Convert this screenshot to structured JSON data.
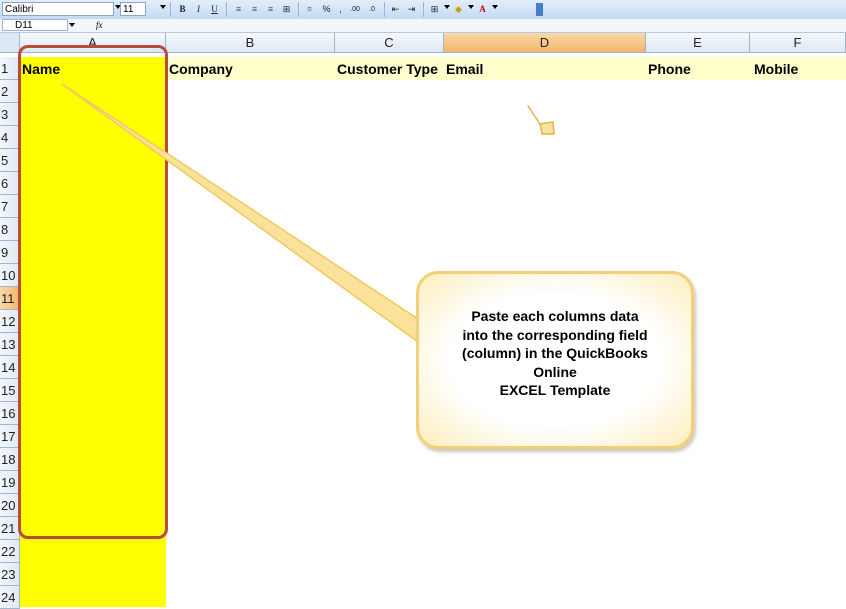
{
  "toolbar": {
    "font_name": "Calibri",
    "font_size": "11",
    "bold_label": "B",
    "italic_label": "I",
    "underline_label": "U",
    "percent_label": "%",
    "comma_label": ",",
    "increase_decimal_label": ".00",
    "decrease_decimal_label": ".0"
  },
  "formula_bar": {
    "name_box": "D11",
    "fx_label": "fx",
    "value": ""
  },
  "columns": [
    "A",
    "B",
    "C",
    "D",
    "E",
    "F"
  ],
  "active_column": "D",
  "active_row": 11,
  "rows": [
    "1",
    "2",
    "3",
    "4",
    "5",
    "6",
    "7",
    "8",
    "9",
    "10",
    "11",
    "12",
    "13",
    "14",
    "15",
    "16",
    "17",
    "18",
    "19",
    "20",
    "21",
    "22",
    "23",
    "24"
  ],
  "header_cells": {
    "A": "Name",
    "B": "Company",
    "C": "Customer Type",
    "D": "Email",
    "E": "Phone",
    "F": "Mobile"
  },
  "callout": {
    "lines": [
      "Paste each columns data",
      "into the corresponding field",
      "(column) in the QuickBooks",
      "Online",
      "EXCEL Template"
    ]
  },
  "colors": {
    "column_highlight": "#ffff00",
    "header_row_fill": "#ffffcc",
    "outline": "#b94a3e",
    "active_header": "#f3b66a",
    "callout_border": "#f2cf79"
  }
}
